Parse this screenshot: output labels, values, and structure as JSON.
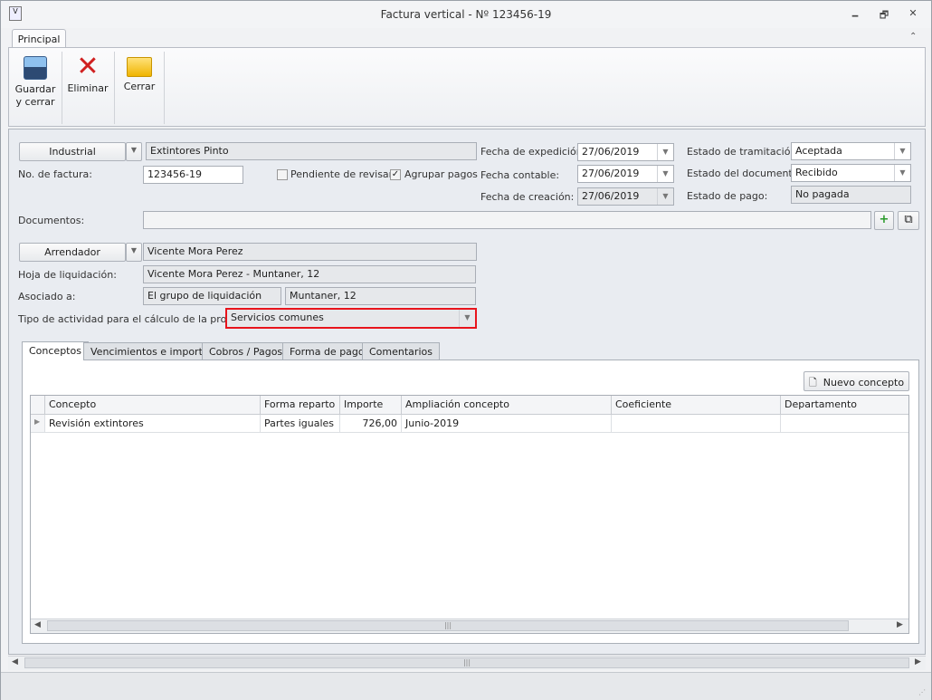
{
  "window": {
    "title": "Factura vertical - Nº 123456-19",
    "minimize": "🗕",
    "restore": "🗗",
    "close": "✕"
  },
  "ribbon": {
    "tab": "Principal",
    "collapse": "⌃",
    "save_l1": "Guardar",
    "save_l2": "y cerrar",
    "delete": "Eliminar",
    "close": "Cerrar"
  },
  "form": {
    "provider_type": "Industrial",
    "provider_name": "Extintores Pinto",
    "invoice_no_label": "No. de factura:",
    "invoice_no": "123456-19",
    "pending_label": "Pendiente de revisar",
    "pending_checked": false,
    "group_label": "Agrupar pagos",
    "group_checked": true,
    "issue_date_label": "Fecha de expedición:",
    "issue_date": "27/06/2019",
    "accounting_date_label": "Fecha contable:",
    "accounting_date": "27/06/2019",
    "creation_date_label": "Fecha de creación:",
    "creation_date": "27/06/2019",
    "processing_label": "Estado de tramitación:",
    "processing": "Aceptada",
    "doc_state_label": "Estado del documento:",
    "doc_state": "Recibido",
    "payment_state_label": "Estado de pago:",
    "payment_state": "No pagada",
    "documents_label": "Documentos:",
    "documents": "",
    "party_type": "Arrendador",
    "party_name": "Vicente Mora Perez",
    "sheet_label": "Hoja de liquidación:",
    "sheet": "Vicente Mora Perez - Muntaner, 12",
    "assoc_label": "Asociado a:",
    "assoc1": "El grupo de liquidación",
    "assoc2": "Muntaner, 12",
    "activity_label": "Tipo de actividad para el cálculo de la prorrata:",
    "activity": "Servicios comunes"
  },
  "tabs": [
    "Conceptos",
    "Vencimientos e importes",
    "Cobros / Pagos",
    "Forma de pago",
    "Comentarios"
  ],
  "grid": {
    "new_button": "Nuevo concepto",
    "columns": [
      "Concepto",
      "Forma reparto",
      "Importe",
      "Ampliación concepto",
      "Coeficiente",
      "Departamento"
    ],
    "rows": [
      [
        "Revisión extintores",
        "Partes iguales",
        "726,00",
        "Junio-2019",
        "",
        ""
      ]
    ]
  },
  "colors": {
    "highlight": "#e8141c",
    "accent": "#2b7bd1"
  }
}
